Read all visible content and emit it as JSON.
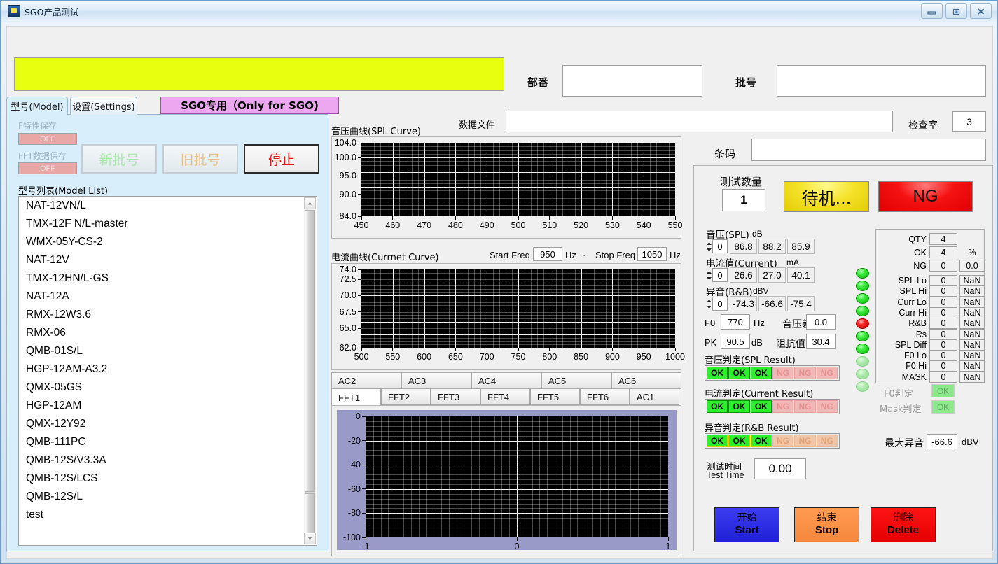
{
  "window": {
    "title": "SGO产品测试",
    "controls": {
      "minimize": "–",
      "restore": "❐",
      "close": "✕"
    }
  },
  "header": {
    "part_no_label": "部番",
    "part_no_value": "",
    "lot_no_label": "批号",
    "lot_no_value": "",
    "data_file_label": "数据文件",
    "data_file_value": "",
    "inspect_room_label": "检查室",
    "inspect_room_value": "3",
    "barcode_label": "条码",
    "barcode_value": "",
    "banner_color": "#e8ff0f"
  },
  "left": {
    "tabs": [
      {
        "label": "型号(Model)",
        "active": true
      },
      {
        "label": "设置(Settings)",
        "active": false
      }
    ],
    "sgo_badge": "SGO专用（Only for SGO)",
    "toggles": [
      {
        "label": "F特性保存",
        "state": "OFF"
      },
      {
        "label": "FFT数据保存",
        "state": "OFF"
      }
    ],
    "buttons": [
      {
        "label": "新批号",
        "enabled": false,
        "color": "#a8e8a8"
      },
      {
        "label": "旧批号",
        "enabled": false,
        "color": "#ecc083"
      },
      {
        "label": "停止",
        "enabled": true,
        "color": "#e21515"
      }
    ],
    "model_list_label": "型号列表(Model List)",
    "models": [
      "NAT-12VN/L",
      "TMX-12F N/L-master",
      "WMX-05Y-CS-2",
      "NAT-12V",
      "TMX-12HN/L-GS",
      "NAT-12A",
      "RMX-12W3.6",
      "RMX-06",
      "QMB-01S/L",
      "HGP-12AM-A3.2",
      "QMX-05GS",
      "HGP-12AM",
      "QMX-12Y92",
      "QMB-111PC",
      "QMB-12S/V3.3A",
      "QMB-12S/LCS",
      "QMB-12S/L",
      "test"
    ]
  },
  "charts": {
    "spl": {
      "title": "音压曲线(SPL Curve)",
      "type": "line",
      "xlabel": "",
      "ylabel": "",
      "xlim": [
        450,
        550
      ],
      "ylim": [
        84.0,
        104.0
      ],
      "xticks": [
        450,
        460,
        470,
        480,
        490,
        500,
        510,
        520,
        530,
        540,
        550
      ],
      "yticks": [
        "104.0",
        "100.0",
        "95.0",
        "90.0",
        "84.0"
      ],
      "ytick_values": [
        104.0,
        100.0,
        95.0,
        90.0,
        84.0
      ],
      "series": [],
      "grid": true,
      "bg": "#000000"
    },
    "current": {
      "title": "电流曲线(Currnet Curve)",
      "type": "line",
      "start_freq_label": "Start Freq",
      "start_freq_value": "950",
      "start_freq_unit": "Hz",
      "tilde": "~",
      "stop_freq_label": "Stop Freq",
      "stop_freq_value": "1050",
      "stop_freq_unit": "Hz",
      "xlim": [
        500,
        1000
      ],
      "ylim": [
        62.0,
        74.0
      ],
      "xticks": [
        500,
        550,
        600,
        650,
        700,
        750,
        800,
        850,
        900,
        950,
        1000
      ],
      "yticks": [
        "74.0",
        "72.5",
        "70.0",
        "67.5",
        "65.0",
        "62.0"
      ],
      "ytick_values": [
        74.0,
        72.5,
        70.0,
        67.5,
        65.0,
        62.0
      ],
      "series": [],
      "grid": true,
      "bg": "#000000"
    },
    "fft": {
      "type": "line",
      "xlim": [
        -1,
        1
      ],
      "ylim": [
        -100,
        0
      ],
      "xticks": [
        -1,
        0,
        1
      ],
      "yticks": [
        "0",
        "-20",
        "-40",
        "-60",
        "-80",
        "-100"
      ],
      "ytick_values": [
        0,
        -20,
        -40,
        -60,
        -80,
        -100
      ],
      "series": [],
      "grid": true,
      "bg": "#000000",
      "frame": "#9a9ac8"
    },
    "tabs_upper": [
      "AC2",
      "AC3",
      "AC4",
      "AC5",
      "AC6"
    ],
    "tabs_lower": [
      {
        "label": "FFT1",
        "active": true
      },
      {
        "label": "FFT2",
        "active": false
      },
      {
        "label": "FFT3",
        "active": false
      },
      {
        "label": "FFT4",
        "active": false
      },
      {
        "label": "FFT5",
        "active": false
      },
      {
        "label": "FFT6",
        "active": false
      },
      {
        "label": "AC1",
        "active": false
      }
    ]
  },
  "right": {
    "test_qty_label": "测试数量",
    "test_qty_value": "1",
    "status_btn": "待机...",
    "result_btn": "NG",
    "measures": [
      {
        "label": "音压(SPL)",
        "unit": "dB",
        "index": "0",
        "values": [
          "86.8",
          "88.2",
          "85.9"
        ]
      },
      {
        "label": "电流值(Current)",
        "unit": "mA",
        "index": "0",
        "values": [
          "26.6",
          "27.0",
          "40.1"
        ]
      },
      {
        "label": "异音(R&B)",
        "unit": "dBV",
        "index": "0",
        "values": [
          "-74.3",
          "-66.6",
          "-75.4"
        ]
      }
    ],
    "f0_label": "F0",
    "f0_value": "770",
    "f0_unit": "Hz",
    "spl_diff_label": "音压差",
    "spl_diff_value": "0.0",
    "pk_label": "PK",
    "pk_value": "90.5",
    "pk_unit": "dB",
    "impedance_label": "阻抗值",
    "impedance_value": "30.4",
    "results": [
      {
        "label": "音压判定(SPL Result)",
        "chips": [
          "OK",
          "OK",
          "OK",
          "NG",
          "NG",
          "NG"
        ],
        "style": "green"
      },
      {
        "label": "电流判定(Current Result)",
        "chips": [
          "OK",
          "OK",
          "OK",
          "NG",
          "NG",
          "NG"
        ],
        "style": "green"
      },
      {
        "label": "异音判定(R&B Result)",
        "chips": [
          "OK",
          "OK",
          "OK",
          "NG",
          "NG",
          "NG"
        ],
        "style": "yellow"
      }
    ],
    "test_time_label_cn": "测试时间",
    "test_time_label_en": "Test Time",
    "test_time_value": "0.00",
    "leds": [
      "on",
      "on",
      "on",
      "on",
      "red",
      "on",
      "on",
      "off",
      "off",
      "off"
    ],
    "stats": {
      "percent_header": "%",
      "summary": [
        {
          "name": "QTY",
          "count": "4",
          "pct": ""
        },
        {
          "name": "OK",
          "count": "4",
          "pct": ""
        },
        {
          "name": "NG",
          "count": "0",
          "pct": "0.0"
        }
      ],
      "rows": [
        {
          "name": "SPL Lo",
          "count": "0",
          "pct": "NaN"
        },
        {
          "name": "SPL Hi",
          "count": "0",
          "pct": "NaN"
        },
        {
          "name": "Curr Lo",
          "count": "0",
          "pct": "NaN"
        },
        {
          "name": "Curr Hi",
          "count": "0",
          "pct": "NaN"
        },
        {
          "name": "R&B",
          "count": "0",
          "pct": "NaN"
        },
        {
          "name": "Rs",
          "count": "0",
          "pct": "NaN"
        },
        {
          "name": "SPL Diff",
          "count": "0",
          "pct": "NaN"
        },
        {
          "name": "F0 Lo",
          "count": "0",
          "pct": "NaN"
        },
        {
          "name": "F0 Hi",
          "count": "0",
          "pct": "NaN"
        },
        {
          "name": "MASK",
          "count": "0",
          "pct": "NaN"
        }
      ]
    },
    "f0_judge_label": "F0判定",
    "f0_judge_value": "OK",
    "mask_judge_label": "Mask判定",
    "mask_judge_value": "OK",
    "max_rb_label": "最大异音",
    "max_rb_value": "-66.6",
    "max_rb_unit": "dBV",
    "actions": [
      {
        "cn": "开始",
        "en": "Start"
      },
      {
        "cn": "结束",
        "en": "Stop"
      },
      {
        "cn": "删除",
        "en": "Delete"
      }
    ]
  }
}
